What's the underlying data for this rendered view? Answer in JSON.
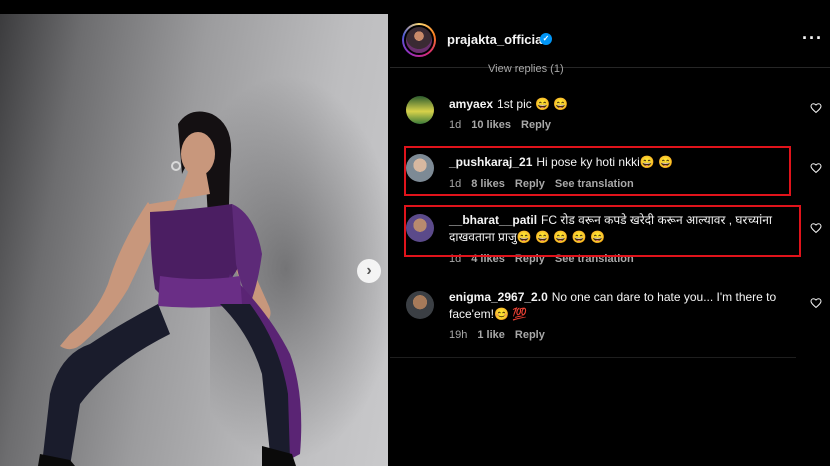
{
  "post": {
    "author": "prajakta_official",
    "verified_icon": "verified-badge-icon",
    "more_icon": "more-options-icon",
    "next_icon": "chevron-right-icon"
  },
  "view_replies": "View replies (1)",
  "comments": [
    {
      "user": "amyaex",
      "text": "1st pic 😄 😄",
      "time": "1d",
      "likes": "10 likes",
      "reply": "Reply",
      "translate": ""
    },
    {
      "user": "_pushkaraj_21",
      "text": "Hi pose ky hoti nkki😄 😄",
      "time": "1d",
      "likes": "8 likes",
      "reply": "Reply",
      "translate": "See translation"
    },
    {
      "user": "__bharat__patil",
      "text": "FC रोड वरून कपडे खरेदी करून आल्यावर , घरच्यांना दाखवताना प्राजु😄 😄 😄 😄 😄",
      "time": "1d",
      "likes": "4 likes",
      "reply": "Reply",
      "translate": "See translation"
    },
    {
      "user": "enigma_2967_2.0",
      "text": "No one can dare to hate you... I'm there to face'em!😊 💯",
      "time": "19h",
      "likes": "1 like",
      "reply": "Reply",
      "translate": ""
    }
  ],
  "colors": {
    "highlight": "#e0131b",
    "verified": "#0095f6",
    "muted_text": "#a8a8a8"
  }
}
